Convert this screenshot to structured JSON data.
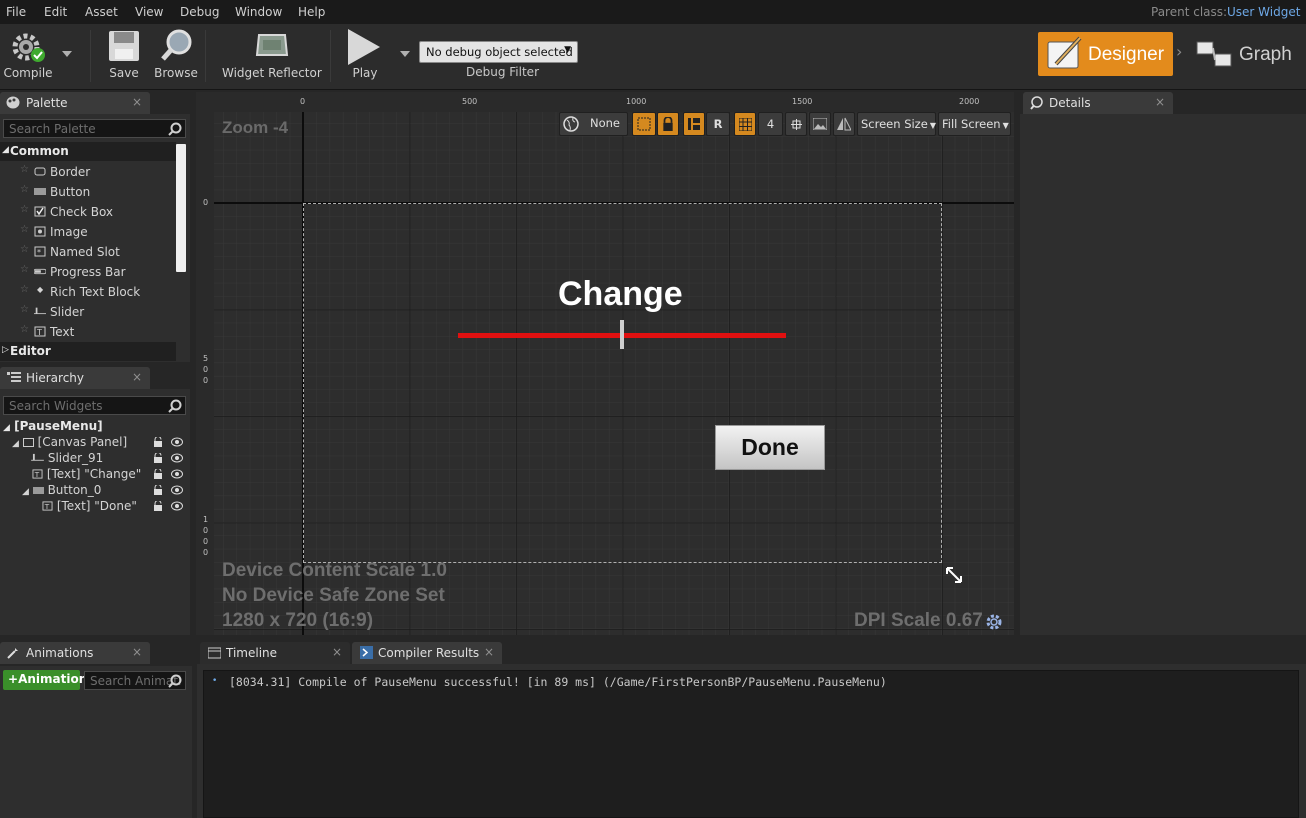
{
  "menu": [
    "File",
    "Edit",
    "Asset",
    "View",
    "Debug",
    "Window",
    "Help"
  ],
  "parent_class": {
    "label": "Parent class:",
    "value": "User Widget"
  },
  "toolbar": {
    "compile": "Compile",
    "save": "Save",
    "browse": "Browse",
    "widget_reflector": "Widget Reflector",
    "play": "Play",
    "debug_object": "No debug object selected",
    "debug_filter": "Debug Filter",
    "designer": "Designer",
    "graph": "Graph"
  },
  "palette": {
    "title": "Palette",
    "search_placeholder": "Search Palette",
    "categories": [
      "Common",
      "Editor"
    ],
    "items": [
      "Border",
      "Button",
      "Check Box",
      "Image",
      "Named Slot",
      "Progress Bar",
      "Rich Text Block",
      "Slider",
      "Text"
    ]
  },
  "hierarchy": {
    "title": "Hierarchy",
    "search_placeholder": "Search Widgets",
    "items": [
      "[PauseMenu]",
      "[Canvas Panel]",
      "Slider_91",
      "[Text] \"Change\"",
      "Button_0",
      "[Text] \"Done\""
    ]
  },
  "viewport": {
    "zoom": "Zoom -4",
    "ruler_top": [
      "0",
      "500",
      "1000",
      "1500",
      "2000"
    ],
    "ruler_left": [
      "0",
      "5",
      "0",
      "0",
      "1",
      "0",
      "0",
      "0"
    ],
    "tools": {
      "none": "None",
      "r": "R",
      "grid": "4",
      "screen_size": "Screen Size",
      "fill_screen": "Fill Screen"
    },
    "change_text": "Change",
    "done_text": "Done",
    "slider_value": 0.5,
    "content_scale": "Device Content Scale 1.0",
    "safe_zone": "No Device Safe Zone Set",
    "resolution": "1280 x 720 (16:9)",
    "dpi": "DPI Scale 0.67"
  },
  "details": {
    "title": "Details"
  },
  "animations": {
    "title": "Animations",
    "add_button": "Animation",
    "search_placeholder": "Search Animati"
  },
  "bottom_tabs": {
    "timeline": "Timeline",
    "compiler": "Compiler Results"
  },
  "compiler_message": "[8034.31] Compile of PauseMenu successful! [in 89 ms] (/Game/FirstPersonBP/PauseMenu.PauseMenu)"
}
